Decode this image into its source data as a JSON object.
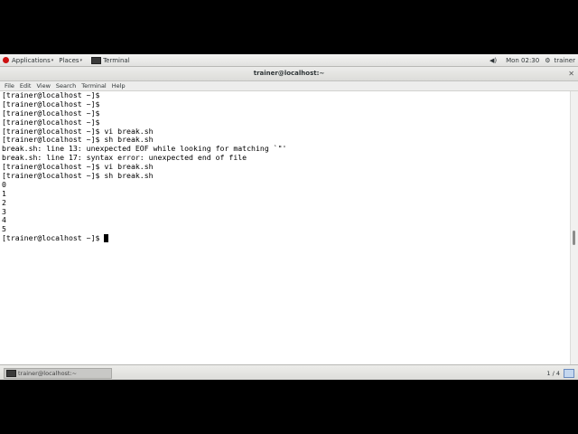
{
  "top_panel": {
    "applications": "Applications",
    "places": "Places",
    "task_title": "Terminal",
    "clock": "Mon 02:30",
    "user": "trainer",
    "volume_icon": "speaker-icon"
  },
  "window": {
    "title": "trainer@localhost:~",
    "close_glyph": "✕"
  },
  "menubar": {
    "items": [
      "File",
      "Edit",
      "View",
      "Search",
      "Terminal",
      "Help"
    ]
  },
  "terminal": {
    "lines": [
      "[trainer@localhost ~]$",
      "[trainer@localhost ~]$",
      "[trainer@localhost ~]$",
      "[trainer@localhost ~]$",
      "[trainer@localhost ~]$ vi break.sh",
      "[trainer@localhost ~]$ sh break.sh",
      "break.sh: line 13: unexpected EOF while looking for matching `\"'",
      "break.sh: line 17: syntax error: unexpected end of file",
      "[trainer@localhost ~]$ vi break.sh",
      "[trainer@localhost ~]$ sh break.sh",
      "0",
      "1",
      "2",
      "3",
      "4",
      "5"
    ],
    "prompt": "[trainer@localhost ~]$ "
  },
  "bottom_panel": {
    "task_label": "trainer@localhost:~",
    "workspace": "1 / 4"
  }
}
